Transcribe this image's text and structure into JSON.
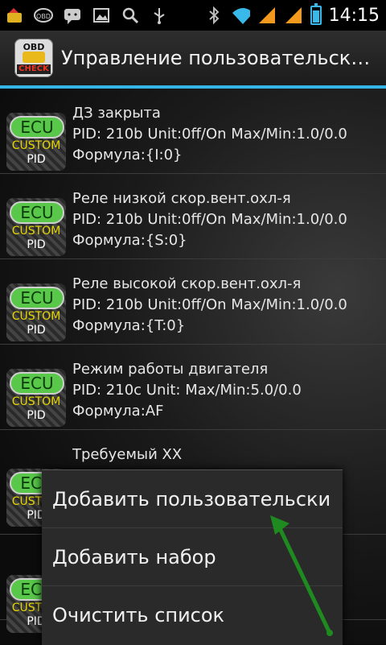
{
  "status_bar": {
    "time": "14:15",
    "icons": [
      "app-warning-icon",
      "obd-icon",
      "chat-icon",
      "image-icon",
      "search-icon",
      "usb-icon",
      "bluetooth-icon",
      "wifi-icon",
      "signal-icon",
      "signal-icon",
      "battery-icon"
    ]
  },
  "action_bar": {
    "app_icon_top": "OBD",
    "app_icon_bottom": "CHECK",
    "title": "Управление пользовательск…"
  },
  "pid_icon": {
    "ecu": "ECU",
    "custom": "CUSTOM",
    "pid": "PID"
  },
  "list": [
    {
      "name": "ДЗ закрыта",
      "pid": "PID: 210b  Unit:0ff/On Max/Min:1.0/0.0",
      "formula": "Формула:{I:0}"
    },
    {
      "name": "Реле низкой скор.вент.охл-я",
      "pid": "PID: 210b  Unit:0ff/On Max/Min:1.0/0.0",
      "formula": "Формула:{S:0}"
    },
    {
      "name": "Реле высокой скор.вент.охл-я",
      "pid": "PID: 210b  Unit:0ff/On Max/Min:1.0/0.0",
      "formula": "Формула:{T:0}"
    },
    {
      "name": "Режим работы двигателя",
      "pid": "PID: 210c  Unit: Max/Min:5.0/0.0",
      "formula": "Формула:AF"
    },
    {
      "name": "Требуемый XX",
      "pid": "",
      "formula": ""
    }
  ],
  "context_menu": [
    {
      "label": "Добавить пользовательски"
    },
    {
      "label": "Добавить набор"
    },
    {
      "label": "Очистить список"
    }
  ],
  "colors": {
    "accent": "#33b5e5",
    "arrow": "#1f8a1f",
    "ecu_green": "#58c74a",
    "custom_yellow": "#e7d600"
  }
}
